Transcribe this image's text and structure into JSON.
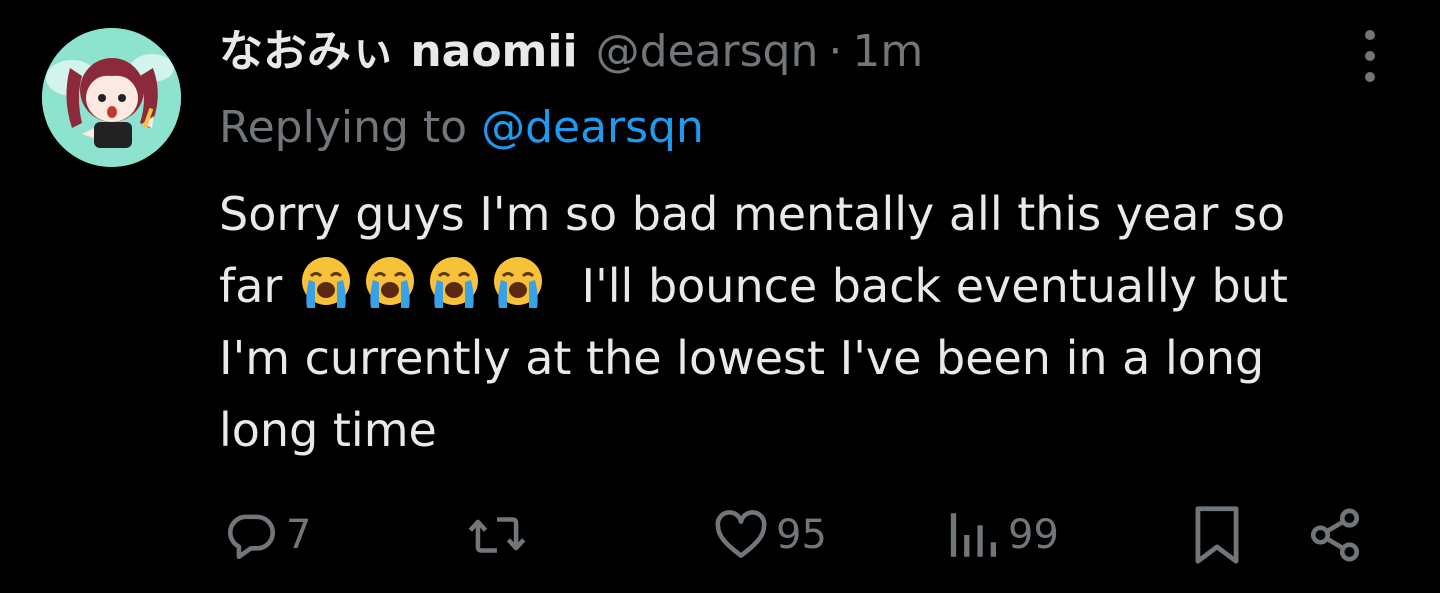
{
  "tweet": {
    "display_name": "なおみぃ naomii",
    "handle": "@dearsqn",
    "separator": "·",
    "time": "1m",
    "replying_prefix": "Replying to",
    "replying_to": "@dearsqn",
    "text_lines": [
      "Sorry guys I'm so bad mentally all this year so",
      "I'll bounce back eventually but",
      "I'm currently at the lowest I've been in a long",
      "long time"
    ],
    "line2_prefix": "far",
    "emojis": [
      "loudly-crying-face",
      "loudly-crying-face",
      "loudly-crying-face",
      "loudly-crying-face"
    ]
  },
  "actions": {
    "reply_count": "7",
    "retweet_count": "",
    "like_count": "95",
    "views_count": "99"
  },
  "colors": {
    "background": "#000000",
    "text": "#e7e9ea",
    "muted": "#71767b",
    "link": "#1d9bf0",
    "avatar_bg": "#8ee3cf"
  }
}
